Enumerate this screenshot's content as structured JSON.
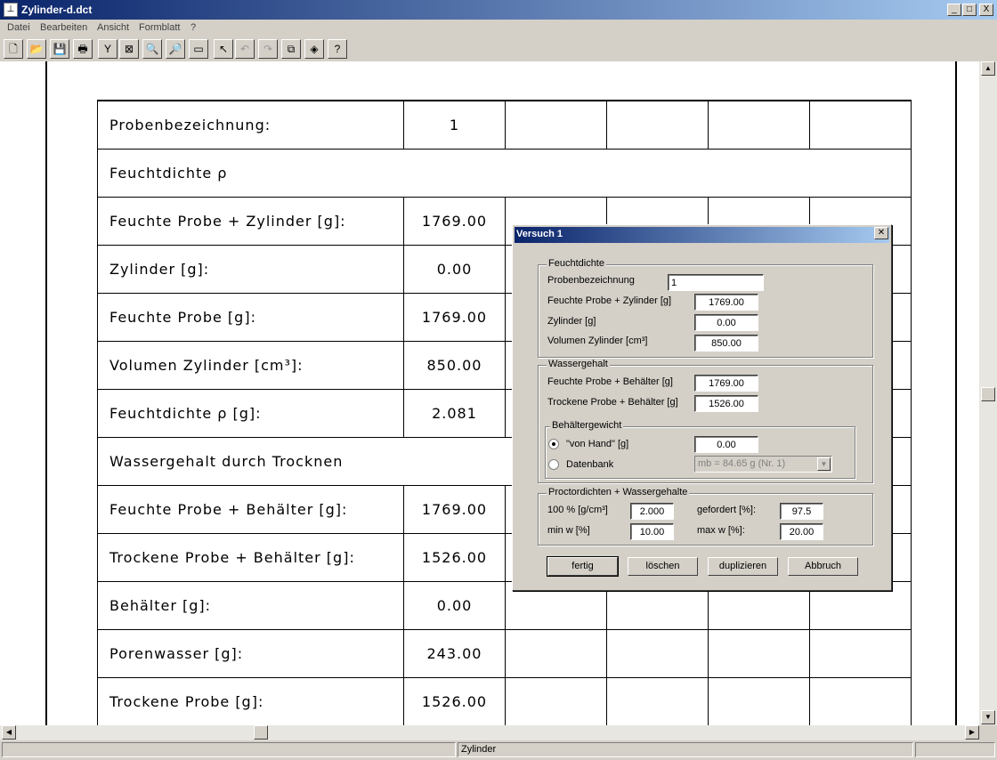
{
  "window": {
    "title": "Zylinder-d.dct",
    "min": "_",
    "max": "□",
    "close": "X"
  },
  "menu": [
    "Datei",
    "Bearbeiten",
    "Ansicht",
    "Formblatt",
    "?"
  ],
  "toolbar": {
    "items": [
      {
        "name": "new-icon",
        "glyph": "🗋"
      },
      {
        "name": "open-icon",
        "glyph": "📂"
      },
      {
        "name": "save-icon",
        "glyph": "💾"
      },
      {
        "name": "print-icon",
        "glyph": "🖶"
      },
      {
        "name": "tool-icon",
        "glyph": "Y"
      },
      {
        "name": "preview-icon",
        "glyph": "⊠"
      },
      {
        "name": "zoom-out-icon",
        "glyph": "🔍"
      },
      {
        "name": "zoom-in-icon",
        "glyph": "🔎"
      },
      {
        "name": "fit-page-icon",
        "glyph": "▭"
      },
      {
        "name": "pointer-icon",
        "glyph": "↖"
      },
      {
        "name": "undo-icon",
        "glyph": "↶",
        "disabled": true
      },
      {
        "name": "redo-icon",
        "glyph": "↷",
        "disabled": true
      },
      {
        "name": "copy-icon",
        "glyph": "⧉"
      },
      {
        "name": "export-icon",
        "glyph": "◈"
      },
      {
        "name": "help-icon",
        "glyph": "?"
      }
    ]
  },
  "sheet": {
    "rows": [
      {
        "label": "Probenbezeichnung:",
        "value": "1",
        "cols": 5
      },
      {
        "label": "Feuchtdichte ρ",
        "value": null,
        "full": true
      },
      {
        "label": "Feuchte Probe + Zylinder [g]:",
        "value": "1769.00",
        "cols": 5
      },
      {
        "label": "Zylinder [g]:",
        "value": "0.00",
        "cols": 5
      },
      {
        "label": "Feuchte Probe [g]:",
        "value": "1769.00",
        "cols": 5
      },
      {
        "label": "Volumen Zylinder [cm³]:",
        "value": "850.00",
        "cols": 5
      },
      {
        "label": "Feuchtdichte ρ [g]:",
        "value": "2.081",
        "cols": 5
      },
      {
        "label": "Wassergehalt durch Trocknen",
        "value": null,
        "full": true
      },
      {
        "label": "Feuchte Probe + Behälter [g]:",
        "value": "1769.00",
        "cols": 5
      },
      {
        "label": "Trockene Probe + Behälter [g]:",
        "value": "1526.00",
        "cols": 5
      },
      {
        "label": "Behälter [g]:",
        "value": "0.00",
        "cols": 5
      },
      {
        "label": "Porenwasser [g]:",
        "value": "243.00",
        "cols": 5
      },
      {
        "label": "Trockene Probe [g]:",
        "value": "1526.00",
        "cols": 5
      }
    ]
  },
  "status": {
    "text": "Zylinder"
  },
  "dialog": {
    "title": "Versuch 1",
    "feuchtdichte": {
      "group": "Feuchtdichte",
      "probenbezeichnung_label": "Probenbezeichnung",
      "probenbezeichnung": "1",
      "feuchte_probe_zylinder_label": "Feuchte Probe + Zylinder [g]",
      "feuchte_probe_zylinder": "1769.00",
      "zylinder_label": "Zylinder [g]",
      "zylinder": "0.00",
      "volumen_label": "Volumen Zylinder [cm³]",
      "volumen": "850.00"
    },
    "wassergehalt": {
      "group": "Wassergehalt",
      "feuchte_probe_behaelter_label": "Feuchte Probe + Behälter [g]",
      "feuchte_probe_behaelter": "1769.00",
      "trockene_probe_behaelter_label": "Trockene Probe + Behälter [g]",
      "trockene_probe_behaelter": "1526.00"
    },
    "behaeltergewicht": {
      "group": "Behältergewicht",
      "von_hand_label": "\"von Hand\" [g]",
      "von_hand": "0.00",
      "datenbank_label": "Datenbank",
      "datenbank_value": "mb = 84.65 g (Nr. 1)"
    },
    "proctor": {
      "group": "Proctordichten + Wassergehalte",
      "p100_label": "100 % [g/cm³]",
      "p100": "2.000",
      "gefordert_label": "gefordert [%]:",
      "gefordert": "97.5",
      "minw_label": "min w [%]",
      "minw": "10.00",
      "maxw_label": "max w [%]:",
      "maxw": "20.00"
    },
    "buttons": {
      "fertig": "fertig",
      "loeschen": "löschen",
      "duplizieren": "duplizieren",
      "abbruch": "Abbruch"
    }
  }
}
